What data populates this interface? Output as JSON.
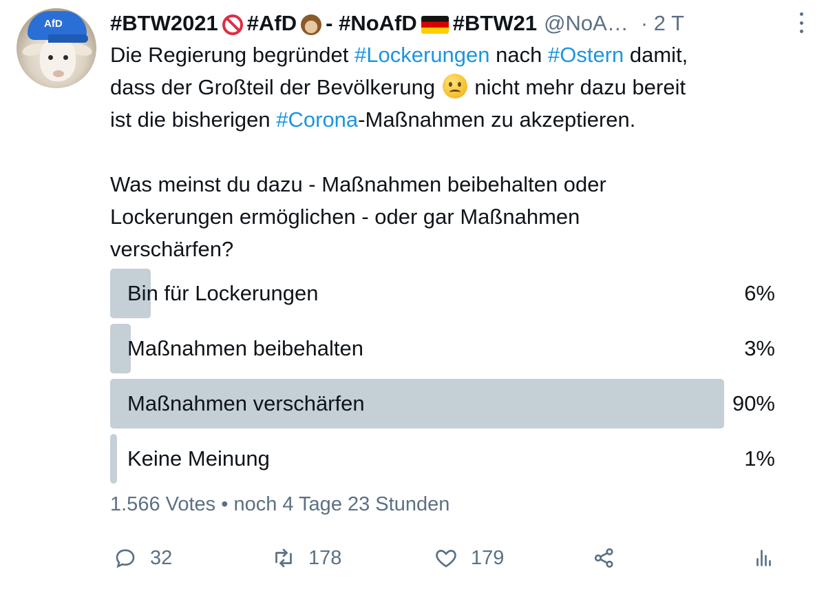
{
  "tweet": {
    "display_name_parts": [
      "#BTW2021",
      "#AfD",
      "- #NoAfD",
      "#BTW21"
    ],
    "handle": "@NoA…",
    "time": "· 2 T",
    "avatar_cap_text": "AfD",
    "text": {
      "line1_pre": "Die Regierung begründet ",
      "line1_tag1": "#Lockerungen",
      "line1_mid": " nach ",
      "line1_tag2": "#Ostern",
      "line1_post": " damit,",
      "line2_pre": "dass der Großteil der Bevölkerung ",
      "line2_post": " nicht mehr dazu bereit",
      "line3_pre": "ist die bisherigen ",
      "line3_tag": "#Corona",
      "line3_post": "-Maßnahmen zu akzeptieren.",
      "question_line1": "Was meinst du dazu - Maßnahmen beibehalten oder",
      "question_line2": "Lockerungen ermöglichen - oder gar Maßnahmen",
      "question_line3": "verschärfen?"
    }
  },
  "poll": {
    "options": [
      {
        "label": "Bin für Lockerungen",
        "percent_text": "6%",
        "fraction": 0.06
      },
      {
        "label": "Maßnahmen beibehalten",
        "percent_text": "3%",
        "fraction": 0.03
      },
      {
        "label": "Maßnahmen verschärfen",
        "percent_text": "90%",
        "fraction": 0.9
      },
      {
        "label": "Keine Meinung",
        "percent_text": "1%",
        "fraction": 0.01
      }
    ],
    "meta": "1.566 Votes • noch 4 Tage 23 Stunden"
  },
  "actions": {
    "reply_count": "32",
    "retweet_count": "178",
    "like_count": "179"
  },
  "colors": {
    "hashtag": "#1b95e0",
    "muted": "#5b7083",
    "poll_bar": "#c4cfd6"
  },
  "icons": {
    "reply": "reply-icon",
    "retweet": "retweet-icon",
    "like": "heart-icon",
    "share": "share-icon",
    "stats": "analytics-icon",
    "more": "more-vertical-icon"
  }
}
